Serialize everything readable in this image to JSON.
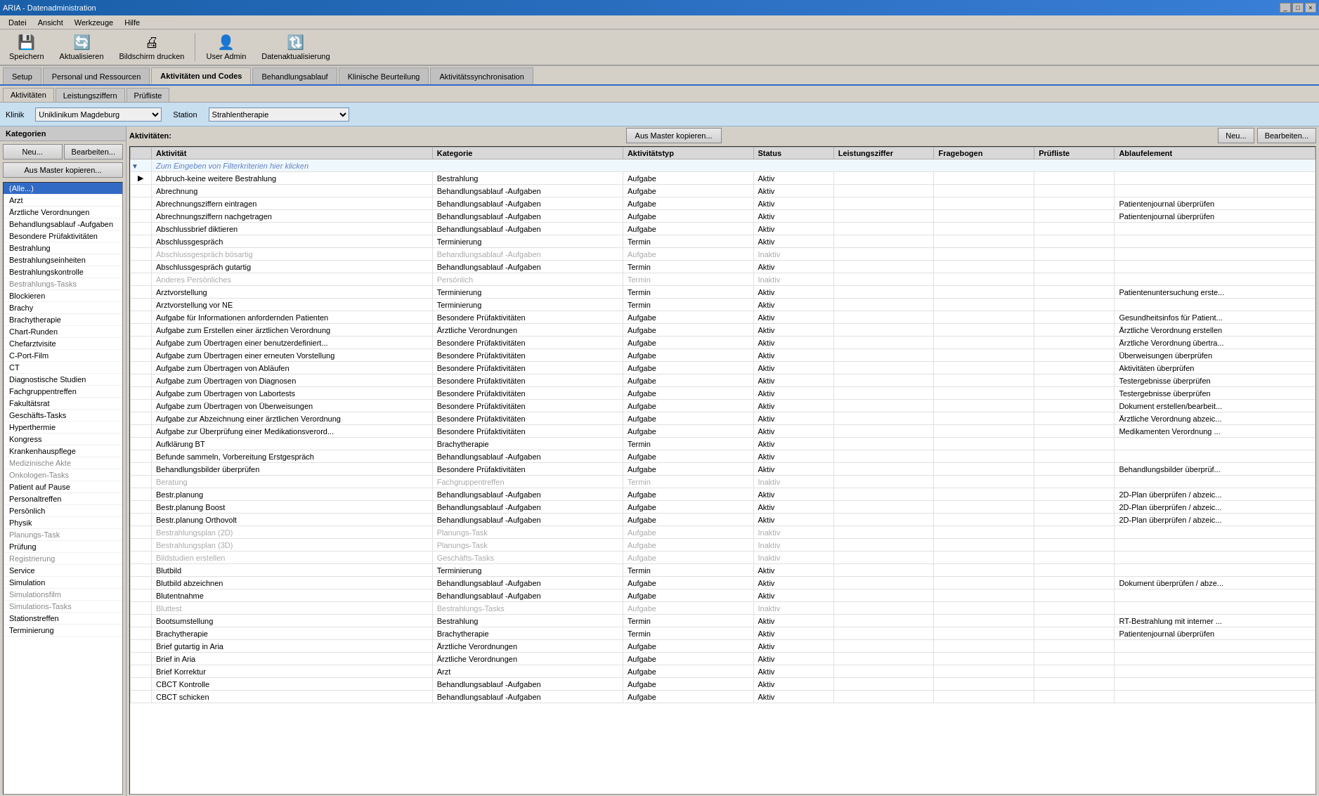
{
  "window": {
    "title": "ARIA - Datenadministration",
    "controls": [
      "_",
      "□",
      "×"
    ]
  },
  "menu": {
    "items": [
      "Datei",
      "Ansicht",
      "Werkzeuge",
      "Hilfe"
    ]
  },
  "toolbar": {
    "buttons": [
      {
        "label": "Speichern",
        "icon": "💾"
      },
      {
        "label": "Aktualisieren",
        "icon": "🔄"
      },
      {
        "label": "Bildschirm drucken",
        "icon": "🖨"
      },
      {
        "label": "User Admin",
        "icon": "👤"
      },
      {
        "label": "Datenaktualisierung",
        "icon": "🔃"
      }
    ]
  },
  "tabs": {
    "main": [
      "Setup",
      "Personal und Ressourcen",
      "Aktivitäten und Codes",
      "Behandlungsablauf",
      "Klinische Beurteilung",
      "Aktivitätssynchronisation"
    ],
    "active_main": "Aktivitäten und Codes",
    "sub": [
      "Aktivitäten",
      "Leistungsziffern",
      "Prüfliste"
    ],
    "active_sub": "Aktivitäten"
  },
  "filter": {
    "klinik_label": "Klinik",
    "klinik_value": "Uniklinikum Magdeburg",
    "station_label": "Station",
    "station_value": "Strahlentherapie"
  },
  "sidebar": {
    "header": "Kategorien",
    "btn_neu": "Neu...",
    "btn_bearbeiten": "Bearbeiten...",
    "btn_master": "Aus Master kopieren...",
    "items": [
      {
        "label": "(Alle...)",
        "selected": true,
        "active": true
      },
      {
        "label": "Arzt",
        "active": true
      },
      {
        "label": "Ärztliche Verordnungen",
        "active": true
      },
      {
        "label": "Behandlungsablauf -Aufgaben",
        "active": true
      },
      {
        "label": "Besondere Prüfaktivitäten",
        "active": true
      },
      {
        "label": "Bestrahlung",
        "active": true
      },
      {
        "label": "Bestrahlungseinheiten",
        "active": true
      },
      {
        "label": "Bestrahlungskontrolle",
        "active": true
      },
      {
        "label": "Bestrahlungs-Tasks",
        "active": false
      },
      {
        "label": "Blockieren",
        "active": true
      },
      {
        "label": "Brachy",
        "active": true
      },
      {
        "label": "Brachytherapie",
        "active": true
      },
      {
        "label": "Chart-Runden",
        "active": true
      },
      {
        "label": "Chefarztvisite",
        "active": true
      },
      {
        "label": "C-Port-Film",
        "active": true
      },
      {
        "label": "CT",
        "active": true
      },
      {
        "label": "Diagnostische Studien",
        "active": true
      },
      {
        "label": "Fachgruppentreffen",
        "active": true
      },
      {
        "label": "Fakultätsrat",
        "active": true
      },
      {
        "label": "Geschäfts-Tasks",
        "active": true
      },
      {
        "label": "Hyperthermie",
        "active": true
      },
      {
        "label": "Kongress",
        "active": true
      },
      {
        "label": "Krankenhauspflege",
        "active": true
      },
      {
        "label": "Medizinische Akte",
        "active": false
      },
      {
        "label": "Onkologen-Tasks",
        "active": false
      },
      {
        "label": "Patient auf Pause",
        "active": true
      },
      {
        "label": "Personaltreffen",
        "active": true
      },
      {
        "label": "Persönlich",
        "active": true
      },
      {
        "label": "Physik",
        "active": true
      },
      {
        "label": "Planungs-Task",
        "active": false
      },
      {
        "label": "Prüfung",
        "active": true
      },
      {
        "label": "Registrierung",
        "active": false
      },
      {
        "label": "Service",
        "active": true
      },
      {
        "label": "Simulation",
        "active": true
      },
      {
        "label": "Simulationsfilm",
        "active": false
      },
      {
        "label": "Simulations-Tasks",
        "active": false
      },
      {
        "label": "Stationstreffen",
        "active": true
      },
      {
        "label": "Terminierung",
        "active": true
      }
    ]
  },
  "activities": {
    "header": "Aktivitäten:",
    "btn_master": "Aus Master kopieren...",
    "btn_neu": "Neu...",
    "btn_bearbeiten": "Bearbeiten...",
    "columns": [
      "Aktivität",
      "Kategorie",
      "Aktivitätstyp",
      "Status",
      "Leistungsziffer",
      "Fragebogen",
      "Prüfliste",
      "Ablaufelement"
    ],
    "filter_placeholder": "Zum Eingeben von Filterkriterien hier klicken",
    "rows": [
      {
        "activity": "Abbruch-keine weitere Bestrahlung",
        "kategorie": "Bestrahlung",
        "typ": "Aufgabe",
        "status": "Aktiv",
        "leistung": "",
        "frage": "",
        "prufliste": "",
        "ablauf": "",
        "active": true,
        "selected": true
      },
      {
        "activity": "Abrechnung",
        "kategorie": "Behandlungsablauf -Aufgaben",
        "typ": "Aufgabe",
        "status": "Aktiv",
        "leistung": "",
        "frage": "",
        "prufliste": "",
        "ablauf": "",
        "active": true
      },
      {
        "activity": "Abrechnungsziffern eintragen",
        "kategorie": "Behandlungsablauf -Aufgaben",
        "typ": "Aufgabe",
        "status": "Aktiv",
        "leistung": "",
        "frage": "",
        "prufliste": "",
        "ablauf": "Patientenjournal überprüfen",
        "active": true
      },
      {
        "activity": "Abrechnungsziffern nachgetragen",
        "kategorie": "Behandlungsablauf -Aufgaben",
        "typ": "Aufgabe",
        "status": "Aktiv",
        "leistung": "",
        "frage": "",
        "prufliste": "",
        "ablauf": "Patientenjournal überprüfen",
        "active": true
      },
      {
        "activity": "Abschlussbrief diktieren",
        "kategorie": "Behandlungsablauf -Aufgaben",
        "typ": "Aufgabe",
        "status": "Aktiv",
        "leistung": "",
        "frage": "",
        "prufliste": "",
        "ablauf": "",
        "active": true
      },
      {
        "activity": "Abschlussgespräch",
        "kategorie": "Terminierung",
        "typ": "Termin",
        "status": "Aktiv",
        "leistung": "",
        "frage": "",
        "prufliste": "",
        "ablauf": "",
        "active": true
      },
      {
        "activity": "Abschlussgespräch bösartig",
        "kategorie": "Behandlungsablauf -Aufgaben",
        "typ": "Aufgabe",
        "status": "Inaktiv",
        "leistung": "",
        "frage": "",
        "prufliste": "",
        "ablauf": "",
        "active": false
      },
      {
        "activity": "Abschlussgespräch gutartig",
        "kategorie": "Behandlungsablauf -Aufgaben",
        "typ": "Termin",
        "status": "Aktiv",
        "leistung": "",
        "frage": "",
        "prufliste": "",
        "ablauf": "",
        "active": true
      },
      {
        "activity": "Anderes Persönliches",
        "kategorie": "Persönlich",
        "typ": "Termin",
        "status": "Inaktiv",
        "leistung": "",
        "frage": "",
        "prufliste": "",
        "ablauf": "",
        "active": false
      },
      {
        "activity": "Arztvorstellung",
        "kategorie": "Terminierung",
        "typ": "Termin",
        "status": "Aktiv",
        "leistung": "",
        "frage": "",
        "prufliste": "",
        "ablauf": "Patientenuntersuchung erste...",
        "active": true
      },
      {
        "activity": "Arztvorstellung vor NE",
        "kategorie": "Terminierung",
        "typ": "Termin",
        "status": "Aktiv",
        "leistung": "",
        "frage": "",
        "prufliste": "",
        "ablauf": "",
        "active": true
      },
      {
        "activity": "Aufgabe für Informationen anfordernden Patienten",
        "kategorie": "Besondere Prüfaktivitäten",
        "typ": "Aufgabe",
        "status": "Aktiv",
        "leistung": "",
        "frage": "",
        "prufliste": "",
        "ablauf": "Gesundheitsinfos für Patient...",
        "active": true
      },
      {
        "activity": "Aufgabe zum Erstellen einer ärztlichen Verordnung",
        "kategorie": "Ärztliche Verordnungen",
        "typ": "Aufgabe",
        "status": "Aktiv",
        "leistung": "",
        "frage": "",
        "prufliste": "",
        "ablauf": "Ärztliche Verordnung erstellen",
        "active": true
      },
      {
        "activity": "Aufgabe zum Übertragen einer benutzerdefiniert...",
        "kategorie": "Besondere Prüfaktivitäten",
        "typ": "Aufgabe",
        "status": "Aktiv",
        "leistung": "",
        "frage": "",
        "prufliste": "",
        "ablauf": "Ärztliche Verordnung übertra...",
        "active": true
      },
      {
        "activity": "Aufgabe zum Übertragen einer erneuten Vorstellung",
        "kategorie": "Besondere Prüfaktivitäten",
        "typ": "Aufgabe",
        "status": "Aktiv",
        "leistung": "",
        "frage": "",
        "prufliste": "",
        "ablauf": "Überweisungen überprüfen",
        "active": true
      },
      {
        "activity": "Aufgabe zum Übertragen von Abläufen",
        "kategorie": "Besondere Prüfaktivitäten",
        "typ": "Aufgabe",
        "status": "Aktiv",
        "leistung": "",
        "frage": "",
        "prufliste": "",
        "ablauf": "Aktivitäten überprüfen",
        "active": true
      },
      {
        "activity": "Aufgabe zum Übertragen von Diagnosen",
        "kategorie": "Besondere Prüfaktivitäten",
        "typ": "Aufgabe",
        "status": "Aktiv",
        "leistung": "",
        "frage": "",
        "prufliste": "",
        "ablauf": "Testergebnisse überprüfen",
        "active": true
      },
      {
        "activity": "Aufgabe zum Übertragen von Labortests",
        "kategorie": "Besondere Prüfaktivitäten",
        "typ": "Aufgabe",
        "status": "Aktiv",
        "leistung": "",
        "frage": "",
        "prufliste": "",
        "ablauf": "Testergebnisse überprüfen",
        "active": true
      },
      {
        "activity": "Aufgabe zum Übertragen von Überweisungen",
        "kategorie": "Besondere Prüfaktivitäten",
        "typ": "Aufgabe",
        "status": "Aktiv",
        "leistung": "",
        "frage": "",
        "prufliste": "",
        "ablauf": "Dokument erstellen/bearbeit...",
        "active": true
      },
      {
        "activity": "Aufgabe zur Abzeichnung einer ärztlichen Verordnung",
        "kategorie": "Besondere Prüfaktivitäten",
        "typ": "Aufgabe",
        "status": "Aktiv",
        "leistung": "",
        "frage": "",
        "prufliste": "",
        "ablauf": "Ärztliche Verordnung abzeic...",
        "active": true
      },
      {
        "activity": "Aufgabe zur Überprüfung einer Medikationsverord...",
        "kategorie": "Besondere Prüfaktivitäten",
        "typ": "Aufgabe",
        "status": "Aktiv",
        "leistung": "",
        "frage": "",
        "prufliste": "",
        "ablauf": "Medikamenten Verordnung ...",
        "active": true
      },
      {
        "activity": "Aufklärung BT",
        "kategorie": "Brachytherapie",
        "typ": "Termin",
        "status": "Aktiv",
        "leistung": "",
        "frage": "",
        "prufliste": "",
        "ablauf": "",
        "active": true
      },
      {
        "activity": "Befunde sammeln, Vorbereitung Erstgespräch",
        "kategorie": "Behandlungsablauf -Aufgaben",
        "typ": "Aufgabe",
        "status": "Aktiv",
        "leistung": "",
        "frage": "",
        "prufliste": "",
        "ablauf": "",
        "active": true
      },
      {
        "activity": "Behandlungsbilder überprüfen",
        "kategorie": "Besondere Prüfaktivitäten",
        "typ": "Aufgabe",
        "status": "Aktiv",
        "leistung": "",
        "frage": "",
        "prufliste": "",
        "ablauf": "Behandlungsbilder überprüf...",
        "active": true
      },
      {
        "activity": "Beratung",
        "kategorie": "Fachgruppentreffen",
        "typ": "Termin",
        "status": "Inaktiv",
        "leistung": "",
        "frage": "",
        "prufliste": "",
        "ablauf": "",
        "active": false
      },
      {
        "activity": "Bestr.planung",
        "kategorie": "Behandlungsablauf -Aufgaben",
        "typ": "Aufgabe",
        "status": "Aktiv",
        "leistung": "",
        "frage": "",
        "prufliste": "",
        "ablauf": "2D-Plan überprüfen / abzeic...",
        "active": true
      },
      {
        "activity": "Bestr.planung Boost",
        "kategorie": "Behandlungsablauf -Aufgaben",
        "typ": "Aufgabe",
        "status": "Aktiv",
        "leistung": "",
        "frage": "",
        "prufliste": "",
        "ablauf": "2D-Plan überprüfen / abzeic...",
        "active": true
      },
      {
        "activity": "Bestr.planung Orthovolt",
        "kategorie": "Behandlungsablauf -Aufgaben",
        "typ": "Aufgabe",
        "status": "Aktiv",
        "leistung": "",
        "frage": "",
        "prufliste": "",
        "ablauf": "2D-Plan überprüfen / abzeic...",
        "active": true
      },
      {
        "activity": "Bestrahlungsplan (2D)",
        "kategorie": "Planungs-Task",
        "typ": "Aufgabe",
        "status": "Inaktiv",
        "leistung": "",
        "frage": "",
        "prufliste": "",
        "ablauf": "",
        "active": false
      },
      {
        "activity": "Bestrahlungsplan (3D)",
        "kategorie": "Planungs-Task",
        "typ": "Aufgabe",
        "status": "Inaktiv",
        "leistung": "",
        "frage": "",
        "prufliste": "",
        "ablauf": "",
        "active": false
      },
      {
        "activity": "Bildstudien erstellen",
        "kategorie": "Geschäfts-Tasks",
        "typ": "Aufgabe",
        "status": "Inaktiv",
        "leistung": "",
        "frage": "",
        "prufliste": "",
        "ablauf": "",
        "active": false
      },
      {
        "activity": "Blutbild",
        "kategorie": "Terminierung",
        "typ": "Termin",
        "status": "Aktiv",
        "leistung": "",
        "frage": "",
        "prufliste": "",
        "ablauf": "",
        "active": true
      },
      {
        "activity": "Blutbild abzeichnen",
        "kategorie": "Behandlungsablauf -Aufgaben",
        "typ": "Aufgabe",
        "status": "Aktiv",
        "leistung": "",
        "frage": "",
        "prufliste": "",
        "ablauf": "Dokument überprüfen / abze...",
        "active": true
      },
      {
        "activity": "Blutentnahme",
        "kategorie": "Behandlungsablauf -Aufgaben",
        "typ": "Aufgabe",
        "status": "Aktiv",
        "leistung": "",
        "frage": "",
        "prufliste": "",
        "ablauf": "",
        "active": true
      },
      {
        "activity": "Bluttest",
        "kategorie": "Bestrahlungs-Tasks",
        "typ": "Aufgabe",
        "status": "Inaktiv",
        "leistung": "",
        "frage": "",
        "prufliste": "",
        "ablauf": "",
        "active": false
      },
      {
        "activity": "Bootsumstellung",
        "kategorie": "Bestrahlung",
        "typ": "Termin",
        "status": "Aktiv",
        "leistung": "",
        "frage": "",
        "prufliste": "",
        "ablauf": "RT-Bestrahlung mit interner ...",
        "active": true
      },
      {
        "activity": "Brachytherapie",
        "kategorie": "Brachytherapie",
        "typ": "Termin",
        "status": "Aktiv",
        "leistung": "",
        "frage": "",
        "prufliste": "",
        "ablauf": "Patientenjournal überprüfen",
        "active": true
      },
      {
        "activity": "Brief gutartig in Aria",
        "kategorie": "Ärztliche Verordnungen",
        "typ": "Aufgabe",
        "status": "Aktiv",
        "leistung": "",
        "frage": "",
        "prufliste": "",
        "ablauf": "",
        "active": true
      },
      {
        "activity": "Brief in Aria",
        "kategorie": "Ärztliche Verordnungen",
        "typ": "Aufgabe",
        "status": "Aktiv",
        "leistung": "",
        "frage": "",
        "prufliste": "",
        "ablauf": "",
        "active": true
      },
      {
        "activity": "Brief Korrektur",
        "kategorie": "Arzt",
        "typ": "Aufgabe",
        "status": "Aktiv",
        "leistung": "",
        "frage": "",
        "prufliste": "",
        "ablauf": "",
        "active": true
      },
      {
        "activity": "CBCT Kontrolle",
        "kategorie": "Behandlungsablauf -Aufgaben",
        "typ": "Aufgabe",
        "status": "Aktiv",
        "leistung": "",
        "frage": "",
        "prufliste": "",
        "ablauf": "",
        "active": true
      },
      {
        "activity": "CBCT schicken",
        "kategorie": "Behandlungsablauf -Aufgaben",
        "typ": "Aufgabe",
        "status": "Aktiv",
        "leistung": "",
        "frage": "",
        "prufliste": "",
        "ablauf": "",
        "active": true
      }
    ]
  }
}
